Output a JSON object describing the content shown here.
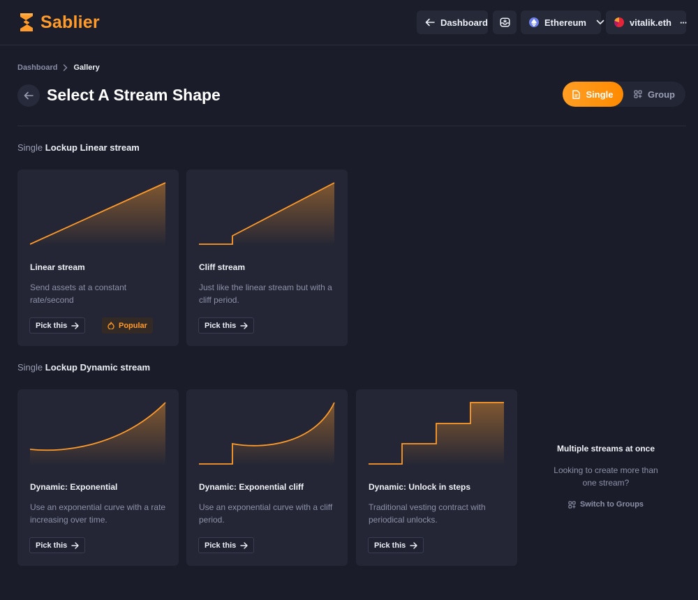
{
  "brand": {
    "name": "Sablier",
    "accent": "#ff9b2a"
  },
  "header": {
    "dashboard_label": "Dashboard",
    "network_label": "Ethereum",
    "account_label": "vitalik.eth",
    "more_glyph": "···"
  },
  "breadcrumb": {
    "root": "Dashboard",
    "current": "Gallery"
  },
  "page": {
    "title": "Select A Stream Shape"
  },
  "toggle": {
    "single_label": "Single",
    "group_label": "Group",
    "selected": "Single"
  },
  "sections": [
    {
      "prefix": "Single",
      "title": "Lockup Linear stream",
      "cards": [
        {
          "title": "Linear stream",
          "desc": "Send assets at a constant rate/second",
          "pick_label": "Pick this",
          "badge": "Popular",
          "shape": "linear"
        },
        {
          "title": "Cliff stream",
          "desc": "Just like the linear stream but with a cliff period.",
          "pick_label": "Pick this",
          "shape": "cliff"
        }
      ]
    },
    {
      "prefix": "Single",
      "title": "Lockup Dynamic stream",
      "cards": [
        {
          "title": "Dynamic: Exponential",
          "desc": "Use an exponential curve with a rate increasing over time.",
          "pick_label": "Pick this",
          "shape": "exponential"
        },
        {
          "title": "Dynamic: Exponential cliff",
          "desc": "Use an exponential curve with a cliff period.",
          "pick_label": "Pick this",
          "shape": "exponential-cliff"
        },
        {
          "title": "Dynamic: Unlock in steps",
          "desc": "Traditional vesting contract with periodical unlocks.",
          "pick_label": "Pick this",
          "shape": "steps"
        }
      ]
    }
  ],
  "groups_promo": {
    "title": "Multiple streams at once",
    "desc": "Looking to create more than one stream?",
    "link_label": "Switch to Groups"
  }
}
